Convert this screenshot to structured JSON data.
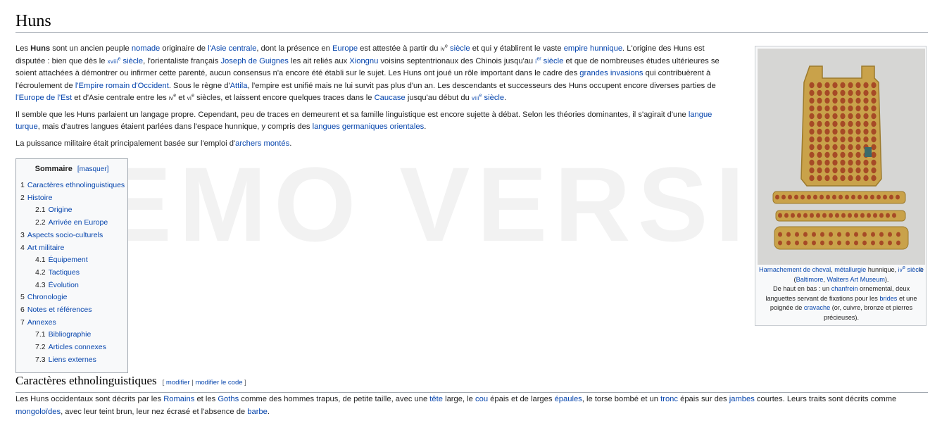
{
  "article": {
    "title": "Huns",
    "p1": [
      {
        "t": "Les "
      },
      {
        "t": "Huns",
        "b": true
      },
      {
        "t": " sont un ancien peuple "
      },
      {
        "t": "nomade",
        "l": true
      },
      {
        "t": " originaire de "
      },
      {
        "t": "l'Asie centrale",
        "l": true
      },
      {
        "t": ", dont la présence en "
      },
      {
        "t": "Europe",
        "l": true
      },
      {
        "t": " est attestée à partir du "
      },
      {
        "t": "iv",
        "sc": true
      },
      {
        "t": "e",
        "sup": true
      },
      {
        "t": " siècle",
        "l": true
      },
      {
        "t": " et qui y établirent le vaste "
      },
      {
        "t": "empire hunnique",
        "l": true
      },
      {
        "t": ". L'origine des Huns est disputée : bien que dès le "
      },
      {
        "t": "xviii",
        "sc": true,
        "l": true
      },
      {
        "t": "e",
        "sup": true,
        "l": true
      },
      {
        "t": " siècle",
        "l": true
      },
      {
        "t": ", l'orientaliste français "
      },
      {
        "t": "Joseph de Guignes",
        "l": true
      },
      {
        "t": " les ait reliés aux "
      },
      {
        "t": "Xiongnu",
        "l": true
      },
      {
        "t": " voisins septentrionaux des Chinois jusqu'au "
      },
      {
        "t": "i",
        "sc": true,
        "l": true
      },
      {
        "t": "er",
        "sup": true,
        "l": true
      },
      {
        "t": " siècle",
        "l": true
      },
      {
        "t": " et que de nombreuses études ultérieures se soient attachées à démontrer ou infirmer cette parenté, aucun consensus n'a encore été établi sur le sujet. Les Huns ont joué un rôle important dans le cadre des "
      },
      {
        "t": "grandes invasions",
        "l": true
      },
      {
        "t": " qui contribuèrent à l'écroulement de "
      },
      {
        "t": "l'Empire romain d'Occident",
        "l": true
      },
      {
        "t": ". Sous le règne d'"
      },
      {
        "t": "Attila",
        "l": true
      },
      {
        "t": ", l'empire est unifié mais ne lui survit pas plus d'un an. Les descendants et successeurs des Huns occupent encore diverses parties de "
      },
      {
        "t": "l'Europe de l'Est",
        "l": true
      },
      {
        "t": " et d'Asie centrale entre les "
      },
      {
        "t": "iv",
        "sc": true
      },
      {
        "t": "e",
        "sup": true
      },
      {
        "t": " et "
      },
      {
        "t": "vi",
        "sc": true
      },
      {
        "t": "e",
        "sup": true
      },
      {
        "t": " siècles, et laissent encore quelques traces dans le "
      },
      {
        "t": "Caucase",
        "l": true
      },
      {
        "t": " jusqu'au début du "
      },
      {
        "t": "viii",
        "sc": true,
        "l": true
      },
      {
        "t": "e",
        "sup": true,
        "l": true
      },
      {
        "t": " siècle",
        "l": true
      },
      {
        "t": "."
      }
    ],
    "p2": [
      {
        "t": "Il semble que les Huns parlaient un langage propre. Cependant, peu de traces en demeurent et sa famille linguistique est encore sujette à débat. Selon les théories dominantes, il s'agirait d'une "
      },
      {
        "t": "langue turque",
        "l": true
      },
      {
        "t": ", mais d'autres langues étaient parlées dans l'espace hunnique, y compris des "
      },
      {
        "t": "langues germaniques orientales",
        "l": true
      },
      {
        "t": "."
      }
    ],
    "p3": [
      {
        "t": "La puissance militaire était principalement basée sur l'emploi d'"
      },
      {
        "t": "archers montés",
        "l": true
      },
      {
        "t": "."
      }
    ]
  },
  "toc": {
    "title": "Sommaire",
    "toggle": "[masquer]",
    "items": [
      {
        "num": "1",
        "label": "Caractères ethnolinguistiques",
        "sub": false
      },
      {
        "num": "2",
        "label": "Histoire",
        "sub": false
      },
      {
        "num": "2.1",
        "label": "Origine",
        "sub": true
      },
      {
        "num": "2.2",
        "label": "Arrivée en Europe",
        "sub": true
      },
      {
        "num": "3",
        "label": "Aspects socio-culturels",
        "sub": false
      },
      {
        "num": "4",
        "label": "Art militaire",
        "sub": false
      },
      {
        "num": "4.1",
        "label": "Équipement",
        "sub": true
      },
      {
        "num": "4.2",
        "label": "Tactiques",
        "sub": true
      },
      {
        "num": "4.3",
        "label": "Évolution",
        "sub": true
      },
      {
        "num": "5",
        "label": "Chronologie",
        "sub": false
      },
      {
        "num": "6",
        "label": "Notes et références",
        "sub": false
      },
      {
        "num": "7",
        "label": "Annexes",
        "sub": false
      },
      {
        "num": "7.1",
        "label": "Bibliographie",
        "sub": true
      },
      {
        "num": "7.2",
        "label": "Articles connexes",
        "sub": true
      },
      {
        "num": "7.3",
        "label": "Liens externes",
        "sub": true
      }
    ]
  },
  "infobox": {
    "caption": [
      {
        "t": "Harnachement de cheval",
        "l": true
      },
      {
        "t": ", "
      },
      {
        "t": "métallurgie",
        "l": true
      },
      {
        "t": " hunnique, "
      },
      {
        "t": "iv",
        "sc": true,
        "l": true
      },
      {
        "t": "e",
        "sup": true,
        "l": true
      },
      {
        "t": " siècle",
        "l": true
      },
      {
        "t": " ("
      },
      {
        "t": "Baltimore",
        "l": true
      },
      {
        "t": ", "
      },
      {
        "t": "Walters Art Museum",
        "l": true
      },
      {
        "t": ")."
      },
      {
        "br": true
      },
      {
        "t": "De haut en bas : un "
      },
      {
        "t": "chanfrein",
        "l": true
      },
      {
        "t": " ornemental, deux languettes servant de fixations pour les "
      },
      {
        "t": "brides",
        "l": true
      },
      {
        "t": " et une poignée de "
      },
      {
        "t": "cravache",
        "l": true
      },
      {
        "t": " (or, cuivre, bronze et pierres précieuses)."
      }
    ],
    "enlarge_icon": "magnify-icon"
  },
  "watermark": "DEMO VERSION",
  "section": {
    "title": "Caractères ethnolinguistiques",
    "edit_open": "[ ",
    "edit_modify": "modifier",
    "edit_sep": " | ",
    "edit_code": "modifier le code",
    "edit_close": " ]",
    "p": [
      {
        "t": "Les Huns occidentaux sont décrits par les "
      },
      {
        "t": "Romains",
        "l": true
      },
      {
        "t": " et les "
      },
      {
        "t": "Goths",
        "l": true
      },
      {
        "t": " comme des hommes trapus, de petite taille, avec une "
      },
      {
        "t": "tête",
        "l": true
      },
      {
        "t": " large, le "
      },
      {
        "t": "cou",
        "l": true
      },
      {
        "t": " épais et de larges "
      },
      {
        "t": "épaules",
        "l": true
      },
      {
        "t": ", le torse bombé et un "
      },
      {
        "t": "tronc",
        "l": true
      },
      {
        "t": " épais sur des "
      },
      {
        "t": "jambes",
        "l": true
      },
      {
        "t": " courtes. Leurs traits sont décrits comme "
      },
      {
        "t": "mongoloïdes",
        "l": true
      },
      {
        "t": ", avec leur teint brun, leur nez écrasé et l'absence de "
      },
      {
        "t": "barbe",
        "l": true
      },
      {
        "t": "."
      }
    ]
  }
}
